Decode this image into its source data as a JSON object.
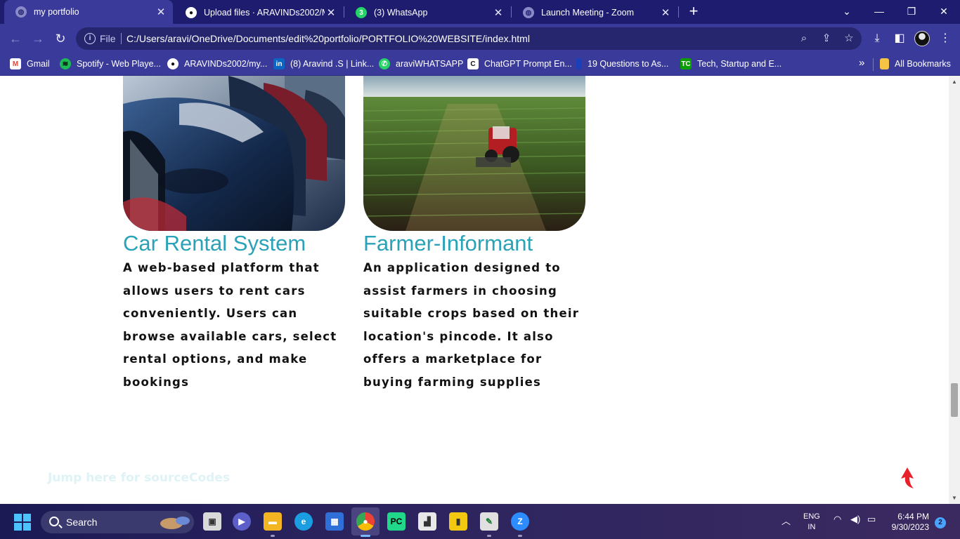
{
  "browser": {
    "tabs": [
      {
        "title": "my portfolio",
        "icon": "globe-icon",
        "active": true
      },
      {
        "title": "Upload files · ARAVINDs2002/M…",
        "icon": "github-icon",
        "active": false
      },
      {
        "title": "(3) WhatsApp",
        "icon": "whatsapp-icon",
        "badge": "3",
        "active": false
      },
      {
        "title": "Launch Meeting - Zoom",
        "icon": "globe-icon",
        "active": false
      }
    ],
    "address": {
      "scheme_label": "File",
      "url": "C:/Users/aravi/OneDrive/Documents/edit%20portfolio/PORTFOLIO%20WEBSITE/index.html"
    },
    "bookmarks": [
      {
        "label": "Gmail",
        "icon": "gmail-icon"
      },
      {
        "label": "Spotify - Web Playe...",
        "icon": "spotify-icon"
      },
      {
        "label": "ARAVINDs2002/my...",
        "icon": "github-icon"
      },
      {
        "label": "(8) Aravind .S | Link...",
        "icon": "linkedin-icon"
      },
      {
        "label": "araviWHATSAPP",
        "icon": "whatsapp-icon"
      },
      {
        "label": "ChatGPT Prompt En...",
        "icon": "chatgpt-icon"
      },
      {
        "label": "19 Questions to As...",
        "icon": "bookmark-icon"
      },
      {
        "label": "Tech, Startup and E...",
        "icon": "techcrunch-icon"
      }
    ],
    "bookmarks_overflow": "»",
    "all_bookmarks": "All Bookmarks"
  },
  "page": {
    "projects": [
      {
        "title": "Car Rental System",
        "description": "A web-based platform that allows users to rent cars conveniently. Users can browse available cars, select rental options, and make bookings",
        "image": "cars-photo"
      },
      {
        "title": "Farmer-Informant",
        "description": "An application designed to assist farmers in choosing suitable crops based on their location's pincode. It also offers a marketplace for buying farming supplies",
        "image": "tractor-field-photo"
      }
    ],
    "jump_link": "Jump here for sourceCodes",
    "back_to_top": "up-arrow-icon"
  },
  "taskbar": {
    "search_placeholder": "Search",
    "language": "ENG",
    "region": "IN",
    "time": "6:44 PM",
    "date": "9/30/2023",
    "notification_count": "2"
  },
  "colors": {
    "tabbar": "#1e1c6e",
    "toolbar": "#3a3a9a",
    "project_title": "#2aa2b8",
    "description_text": "#121212"
  }
}
